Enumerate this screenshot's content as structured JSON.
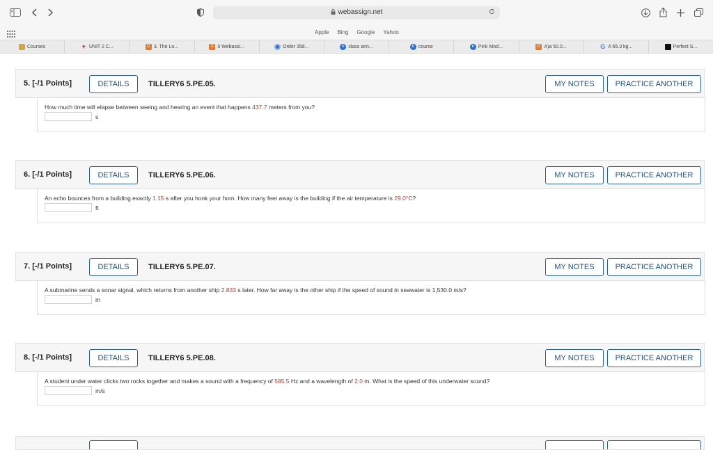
{
  "browser": {
    "url": "webassign.net",
    "favorites": [
      "Apple",
      "Bing",
      "Google",
      "Yahoo"
    ],
    "tabs": [
      {
        "label": "Courses",
        "icon": "folder-icon"
      },
      {
        "label": "UNIT 2 C...",
        "icon": "red-logo-icon"
      },
      {
        "label": "3. The Lo...",
        "icon": "orange-c-icon"
      },
      {
        "label": "0 Webassi...",
        "icon": "orange-c-icon"
      },
      {
        "label": "Order 358...",
        "icon": "blue-circle-icon"
      },
      {
        "label": "class ann...",
        "icon": "blue-c-icon"
      },
      {
        "label": "course",
        "icon": "blue-c-icon"
      },
      {
        "label": "Pink Mod...",
        "icon": "blue-c-icon"
      },
      {
        "label": "A)a 50.0...",
        "icon": "orange-c-icon"
      },
      {
        "label": "A 65.3 kg...",
        "icon": "google-icon"
      },
      {
        "label": "Perfect S...",
        "icon": "black-square-icon"
      }
    ]
  },
  "buttons": {
    "details": "DETAILS",
    "my_notes": "MY NOTES",
    "practice_another": "PRACTICE ANOTHER"
  },
  "questions": [
    {
      "number": "5. [-/1 Points]",
      "code": "TILLERY6 5.PE.05.",
      "text_parts": [
        "How much time will elapse between seeing and hearing an event that happens ",
        "437.7",
        " meters from you?"
      ],
      "unit": "s",
      "answer": ""
    },
    {
      "number": "6. [-/1 Points]",
      "code": "TILLERY6 5.PE.06.",
      "text_parts": [
        "An echo bounces from a building exactly ",
        "1.15",
        " s after you honk your horn. How many feet away is the building if the air temperature is ",
        "29.0°C",
        "?"
      ],
      "unit": "ft",
      "answer": ""
    },
    {
      "number": "7. [-/1 Points]",
      "code": "TILLERY6 5.PE.07.",
      "text_parts": [
        "A submarine sends a sonar signal, which returns from another ship ",
        "2.833",
        " s later. How far away is the other ship if the speed of sound in seawater is 1,530.0 m/s?"
      ],
      "unit": "m",
      "answer": ""
    },
    {
      "number": "8. [-/1 Points]",
      "code": "TILLERY6 5.PE.08.",
      "text_parts": [
        "A student under water clicks two rocks together and makes a sound with a frequency of ",
        "585.5",
        " Hz and a wavelength of ",
        "2.0",
        " m. What is the speed of this underwater sound?"
      ],
      "unit": "m/s",
      "answer": ""
    }
  ],
  "colors": {
    "accent": "#2b5f9e",
    "highlight": "#c0392b"
  }
}
